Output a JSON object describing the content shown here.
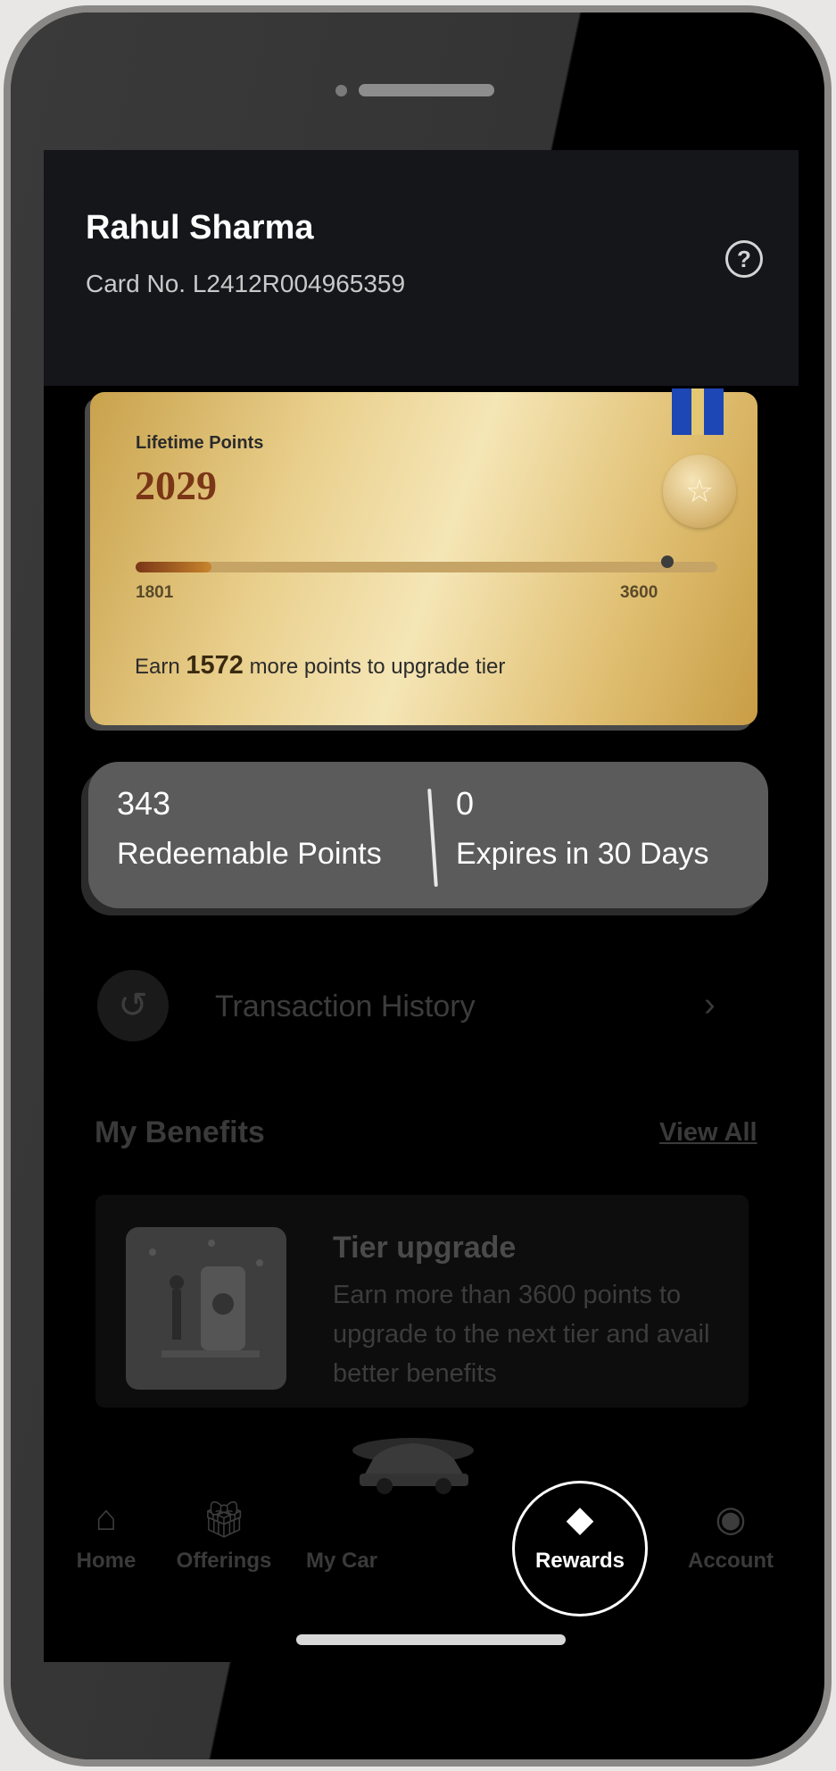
{
  "user": {
    "name": "Rahul Sharma",
    "card_number": "Card No. L2412R004965359"
  },
  "help_icon": "help-circle-icon",
  "tier_card": {
    "label": "Lifetime Points",
    "value": "2029",
    "progress_min": "1801",
    "progress_max": "3600",
    "progress_fraction": 0.13,
    "earn_prefix": "Earn",
    "earn_points": "1572",
    "earn_suffix": "more points to upgrade tier"
  },
  "points": {
    "redeemable_value": "343",
    "redeemable_label": "Redeemable Points",
    "expiring_value": "0",
    "expiring_label": "Expires in 30 Days"
  },
  "transaction_history": {
    "label": "Transaction History",
    "icon": "history-icon",
    "chevron": "›"
  },
  "benefits": {
    "title": "My Benefits",
    "view_all": "View All",
    "items": [
      {
        "title": "Tier upgrade",
        "description": "Earn more than 3600 points to upgrade to the next tier and avail better benefits"
      }
    ]
  },
  "bottom_nav": [
    {
      "label": "Home",
      "icon": "home-icon"
    },
    {
      "label": "Offerings",
      "icon": "gift-icon"
    },
    {
      "label": "My Car",
      "icon": "car-icon"
    },
    {
      "label": "Rewards",
      "icon": "diamond-icon",
      "active": true
    },
    {
      "label": "Account",
      "icon": "user-circle-icon"
    }
  ],
  "colors": {
    "gold": "#e9cf8c",
    "points_value": "#7a3617",
    "pill": "#5b5b5b",
    "header": "#15161a"
  }
}
